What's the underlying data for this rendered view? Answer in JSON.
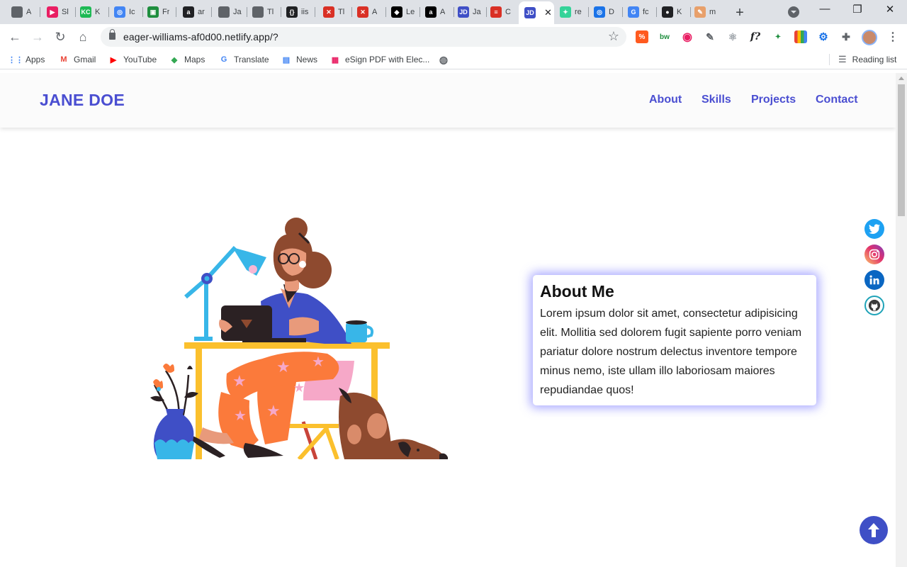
{
  "browser": {
    "tabs": [
      {
        "title": "A",
        "color": "#5f6368",
        "glyph": ""
      },
      {
        "title": "Sl",
        "color": "#e91e63",
        "glyph": "▶"
      },
      {
        "title": "K",
        "color": "#1db954",
        "glyph": "KC"
      },
      {
        "title": "Ic",
        "color": "#4285f4",
        "glyph": "◎"
      },
      {
        "title": "Fr",
        "color": "#1e8e3e",
        "glyph": "▣"
      },
      {
        "title": "ar",
        "color": "#202124",
        "glyph": "a"
      },
      {
        "title": "Ja",
        "color": "#5f6368",
        "glyph": ""
      },
      {
        "title": "Tl",
        "color": "#5f6368",
        "glyph": ""
      },
      {
        "title": "iis",
        "color": "#202124",
        "glyph": "{}"
      },
      {
        "title": "Tl",
        "color": "#d93025",
        "glyph": "✕"
      },
      {
        "title": "A",
        "color": "#d93025",
        "glyph": "✕"
      },
      {
        "title": "Le",
        "color": "#000000",
        "glyph": "◆"
      },
      {
        "title": "A",
        "color": "#000000",
        "glyph": "a"
      },
      {
        "title": "Ja",
        "color": "#3f4fc6",
        "glyph": "JD"
      },
      {
        "title": "C",
        "color": "#d93025",
        "glyph": "≡"
      },
      {
        "title": "",
        "color": "#3f4fc6",
        "glyph": "JD",
        "active": true
      },
      {
        "title": "re",
        "color": "#34d399",
        "glyph": "✦"
      },
      {
        "title": "D",
        "color": "#1a73e8",
        "glyph": "◎"
      },
      {
        "title": "fc",
        "color": "#4285f4",
        "glyph": "G"
      },
      {
        "title": "K",
        "color": "#202124",
        "glyph": "●"
      },
      {
        "title": "m",
        "color": "#e8a06b",
        "glyph": "✎"
      }
    ],
    "url": "eager-williams-af0d00.netlify.app/?",
    "bookmarks": [
      {
        "label": "Apps",
        "icon": "apps-grid-icon",
        "color": "#4285f4",
        "glyph": "⋮⋮"
      },
      {
        "label": "Gmail",
        "icon": "gmail-icon",
        "color": "#ea4335",
        "glyph": "M"
      },
      {
        "label": "YouTube",
        "icon": "youtube-icon",
        "color": "#ff0000",
        "glyph": "▶"
      },
      {
        "label": "Maps",
        "icon": "maps-icon",
        "color": "#34a853",
        "glyph": "◆"
      },
      {
        "label": "Translate",
        "icon": "translate-icon",
        "color": "#4285f4",
        "glyph": "G"
      },
      {
        "label": "News",
        "icon": "news-icon",
        "color": "#4285f4",
        "glyph": "▤"
      },
      {
        "label": "eSign PDF with Elec...",
        "icon": "esign-icon",
        "color": "#e91e63",
        "glyph": "▦"
      }
    ],
    "reading_list": "Reading list"
  },
  "site": {
    "brand": "JANE DOE",
    "nav": [
      "About",
      "Skills",
      "Projects",
      "Contact"
    ],
    "about": {
      "title": "About Me",
      "text": "Lorem ipsum dolor sit amet, consectetur adipisicing elit. Mollitia sed dolorem fugit sapiente porro veniam pariatur dolore nostrum delectus inventore tempore minus nemo, iste ullam illo laboriosam maiores repudiandae quos!"
    },
    "social": [
      {
        "name": "twitter",
        "color": "#1da1f2"
      },
      {
        "name": "instagram",
        "color": "#e1306c"
      },
      {
        "name": "linkedin",
        "color": "#0a66c2"
      },
      {
        "name": "github",
        "color": "#1fa3b8"
      }
    ],
    "colors": {
      "accent": "#4a4ed1",
      "glow": "#6868ff",
      "scroll_button": "#3f4fc6"
    }
  }
}
